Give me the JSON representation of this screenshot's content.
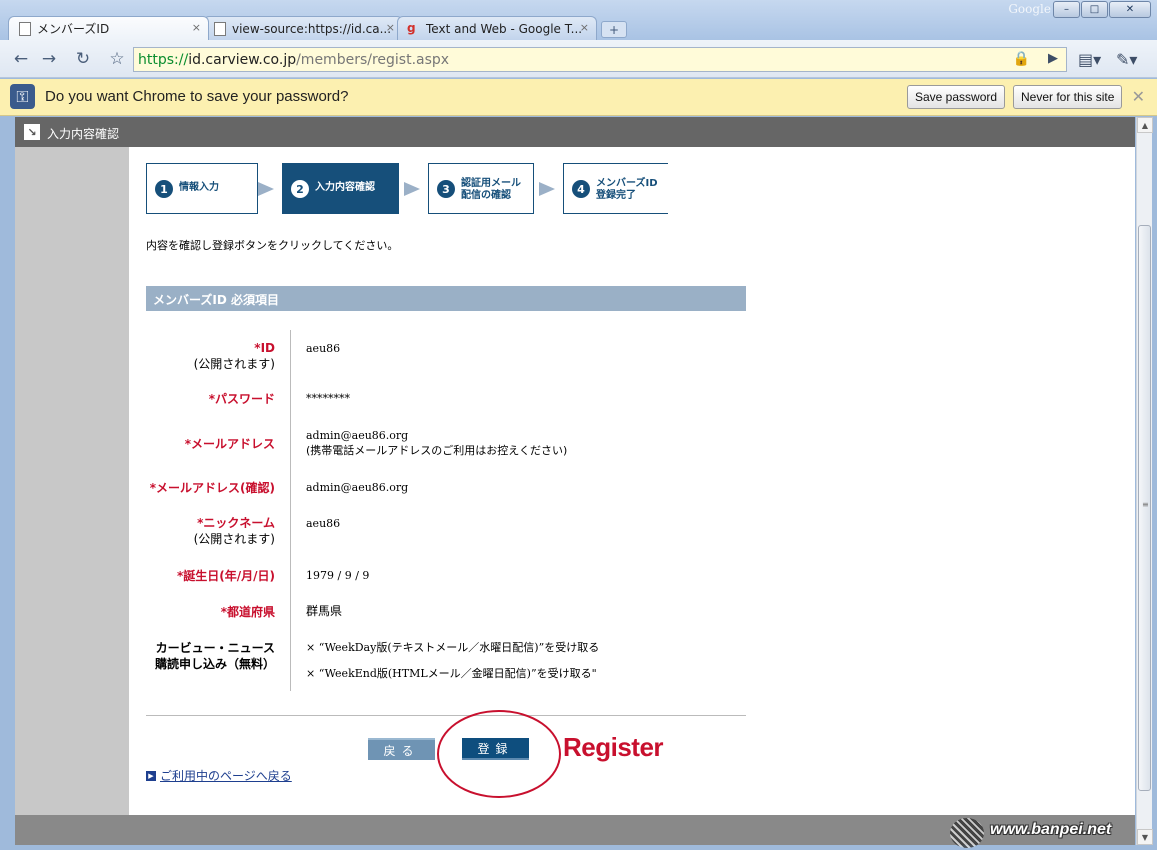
{
  "window": {
    "brand": "Google",
    "controls": {
      "minimize": "–",
      "maximize": "□",
      "close": "✕"
    }
  },
  "tabs": [
    {
      "title": "メンバーズID",
      "close": "×"
    },
    {
      "title": "view-source:https://id.ca...",
      "close": "×"
    },
    {
      "title": "Text and Web - Google T...",
      "close": "×"
    }
  ],
  "toolbar": {
    "url_scheme": "https://",
    "url_host": "id.carview.co.jp",
    "url_path": "/members/regist.aspx",
    "back_icon": "back-arrow-icon",
    "forward_icon": "forward-arrow-icon",
    "reload_icon": "reload-icon",
    "star_icon": "star-icon"
  },
  "infobar": {
    "message": "Do you want Chrome to save your password?",
    "save_label": "Save password",
    "never_label": "Never for this site",
    "close": "✕"
  },
  "page": {
    "section_title": "入力内容確認",
    "steps": [
      {
        "num": "1",
        "label": "情報入力"
      },
      {
        "num": "2",
        "label": "入力内容確認"
      },
      {
        "num": "3",
        "label1": "認証用メール",
        "label2": "配信の確認"
      },
      {
        "num": "4",
        "label1": "メンバーズID",
        "label2": "登録完了"
      }
    ],
    "instruction": "内容を確認し登録ボタンをクリックしてください。",
    "required_header": "メンバーズID 必須項目",
    "fields": {
      "id_label": "*ID",
      "id_sub": "(公開されます)",
      "id_value": "aeu86",
      "password_label": "*パスワード",
      "password_value": "********",
      "email_label": "*メールアドレス",
      "email_value": "admin@aeu86.org",
      "email_note": "(携帯電話メールアドレスのご利用はお控えください)",
      "email_confirm_label": "*メールアドレス(確認)",
      "email_confirm_value": "admin@aeu86.org",
      "nickname_label": "*ニックネーム",
      "nickname_sub": "(公開されます)",
      "nickname_value": "aeu86",
      "birthday_label": "*誕生日(年/月/日)",
      "birthday_value": "1979 / 9 / 9",
      "prefecture_label": "*都道府県",
      "prefecture_value": "群馬県",
      "news_label1": "カービュー・ニュース",
      "news_label2": "購読申し込み（無料）",
      "news_opt1": "× “WeekDay版(テキストメール／水曜日配信)”を受け取る",
      "news_opt2": "× “WeekEnd版(HTMLメール／金曜日配信)”を受け取る\""
    },
    "back_button": "戻る",
    "register_button": "登録",
    "annotation": "Register",
    "return_link": "ご利用中のページへ戻る"
  },
  "watermark": {
    "text": "www.banpei.net"
  }
}
